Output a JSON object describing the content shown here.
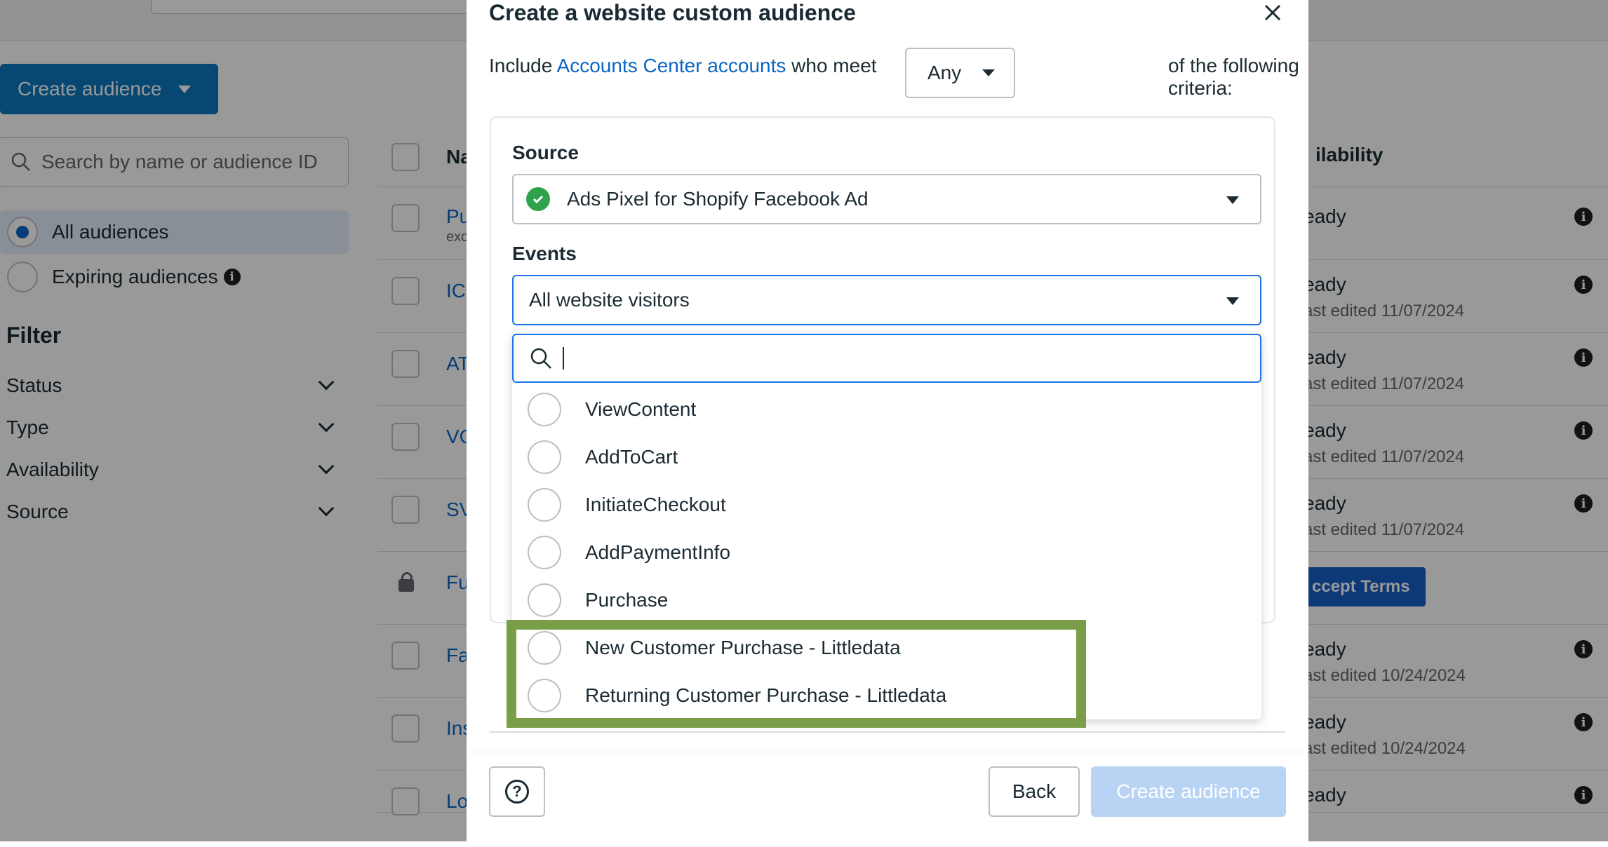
{
  "background": {
    "create_audience_label": "Create audience",
    "search_placeholder": "Search by name or audience ID",
    "audience_filters": [
      {
        "label": "All audiences",
        "selected": true
      },
      {
        "label": "Expiring audiences",
        "selected": false
      }
    ],
    "filter_title": "Filter",
    "filters": [
      "Status",
      "Type",
      "Availability",
      "Source"
    ],
    "table": {
      "name_header": "Na",
      "availability_header": "ilability",
      "rows": [
        {
          "name": "Pu",
          "sub": "exc",
          "status": "eady",
          "edited": ""
        },
        {
          "name": "IC",
          "sub": "",
          "status": "eady",
          "edited": "ast edited 11/07/2024"
        },
        {
          "name": "AT",
          "sub": "",
          "status": "eady",
          "edited": "ast edited 11/07/2024"
        },
        {
          "name": "VC",
          "sub": "",
          "status": "eady",
          "edited": "ast edited 11/07/2024"
        },
        {
          "name": "SV",
          "sub": "",
          "status": "eady",
          "edited": "ast edited 11/07/2024"
        },
        {
          "name": "Fu",
          "sub": "",
          "status": "",
          "edited": ""
        },
        {
          "name": "Fa",
          "sub": "",
          "status": "eady",
          "edited": "ast edited 10/24/2024"
        },
        {
          "name": "Ins",
          "sub": "",
          "status": "eady",
          "edited": "ast edited 10/24/2024"
        },
        {
          "name": "Lo",
          "sub": "",
          "status": "eady",
          "edited": ""
        }
      ],
      "accept_terms_label": "ccept Terms"
    }
  },
  "modal": {
    "title": "Create a website custom audience",
    "include_prefix": "Include",
    "include_link": "Accounts Center accounts",
    "include_middle": "who meet",
    "match_value": "Any",
    "include_suffix": "of the following criteria:",
    "source_label": "Source",
    "source_value": "Ads Pixel for Shopify Facebook Ad",
    "events_label": "Events",
    "events_value": "All website visitors",
    "dropdown_search_value": "",
    "event_options": [
      "ViewContent",
      "AddToCart",
      "InitiateCheckout",
      "AddPaymentInfo",
      "Purchase",
      "New Customer Purchase - Littledata",
      "Returning Customer Purchase - Littledata"
    ],
    "help_symbol": "?",
    "back_label": "Back",
    "create_label": "Create audience"
  },
  "colors": {
    "highlight_border": "#7a9e47",
    "link": "#0a66c2",
    "primary_disabled": "#b9d3f5",
    "check_green": "#31a24c"
  }
}
